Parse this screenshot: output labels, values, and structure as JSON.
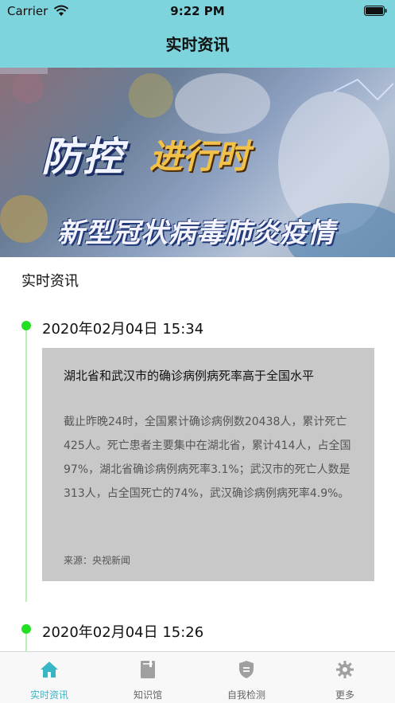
{
  "status_bar": {
    "carrier": "Carrier",
    "time": "9:22 PM"
  },
  "nav": {
    "title": "实时资讯"
  },
  "banner": {
    "title_main": "防控",
    "title_accent": "进行时",
    "subtitle": "新型冠状病毒肺炎疫情"
  },
  "section": {
    "title": "实时资讯"
  },
  "timeline": [
    {
      "date": "2020年02月04日 15:34",
      "title": "湖北省和武汉市的确诊病例病死率高于全国水平",
      "body": "截止昨晚24时，全国累计确诊病例数20438人，累计死亡425人。死亡患者主要集中在湖北省，累计414人，占全国97%，湖北省确诊病例病死率3.1%；武汉市的死亡人数是313人，占全国死亡的74%，武汉确诊病例病死率4.9%。",
      "source": "来源：央视新闻"
    },
    {
      "date": "2020年02月04日 15:26"
    }
  ],
  "tabs": [
    {
      "label": "实时资讯",
      "icon": "home-icon",
      "active": true
    },
    {
      "label": "知识馆",
      "icon": "book-icon",
      "active": false
    },
    {
      "label": "自我检测",
      "icon": "shield-icon",
      "active": false
    },
    {
      "label": "更多",
      "icon": "gear-icon",
      "active": false
    }
  ],
  "colors": {
    "header": "#7ed4dc",
    "accent": "#39b6c6",
    "timeline_dot": "#22e022",
    "card": "#c8c8c8"
  }
}
